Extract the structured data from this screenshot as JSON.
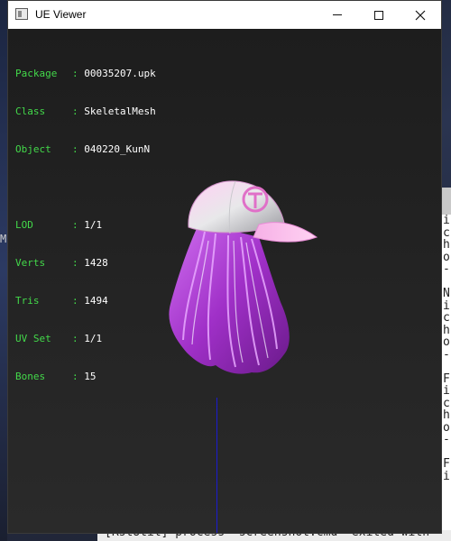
{
  "window": {
    "title": "UE Viewer",
    "buttons": {
      "minimize": "minimize",
      "maximize": "maximize",
      "close": "close"
    }
  },
  "info": {
    "package": {
      "key": "Package",
      "sep": ": ",
      "value": "00035207.upk"
    },
    "class": {
      "key": "Class",
      "sep": ": ",
      "value": "SkeletalMesh"
    },
    "object": {
      "key": "Object",
      "sep": ": ",
      "value": "040220_KunN"
    },
    "lod": {
      "key": "LOD",
      "sep": ": ",
      "value": "1/1"
    },
    "verts": {
      "key": "Verts",
      "sep": ": ",
      "value": "1428"
    },
    "tris": {
      "key": "Tris",
      "sep": ": ",
      "value": "1494"
    },
    "uvset": {
      "key": "UV Set",
      "sep": ": ",
      "value": "1/1"
    },
    "bones": {
      "key": "Bones",
      "sep": ": ",
      "value": "15"
    }
  },
  "colors": {
    "info_label": "#43d94a",
    "info_value": "#ffffff",
    "axis": "#1b1bd0",
    "hair": "#b040d8",
    "cap": "#e8e8ea",
    "cap_brim": "#f0a8e0"
  },
  "background_terminal": {
    "right_lines": "i\nc\nh\no\n-\n\nN\ni\nc\nh\no\n-\n\nF\ni\nc\nh\no\n-\n\nF\ni",
    "side_char": "M",
    "bottom_line": "[RstUtil] process \"screenshot.cmd\" exited with"
  }
}
